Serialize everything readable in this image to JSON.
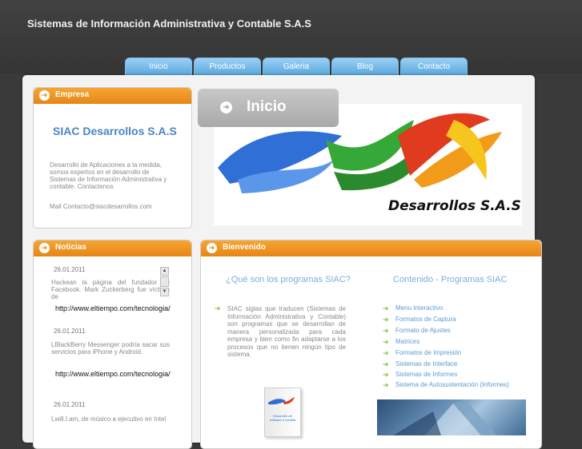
{
  "site": {
    "title": "Sistemas de Información Administrativa y Contable S.A.S"
  },
  "nav": {
    "tabs": [
      "Inicio",
      "Productos",
      "Galeria",
      "Blog",
      "Contacto"
    ]
  },
  "empresa": {
    "header": "Empresa",
    "company": "SIAC Desarrollos S.A.S",
    "description": "Desarrollo de Aplicaciones a la medida, somos expertos en el desarrollo de Sistemas de Información Administrativa y contable. Contactenos",
    "mail": "Mail Contacto@siacdesarrollos.com"
  },
  "noticias": {
    "header": "Noticias",
    "items": [
      {
        "date": "26.01.2011",
        "text": "Hackean la página del fundador de Facebook. Mark Zuckerberg fue víctima de",
        "link": "http://www.eltiempo.com/tecnologia/"
      },
      {
        "date": "26.01.2011",
        "text": "LBlackBerry Messenger podría sacar sus servicios para iPhone y Android.",
        "link": "http://www.eltiempo.com/tecnologia/"
      },
      {
        "date": "26.01.2011",
        "text": "Lwill.I.am, de músico a ejecutivo en Intel"
      }
    ]
  },
  "inicio": {
    "label": "Inicio"
  },
  "logo": {
    "text": "Desarrollos S.A.S"
  },
  "bienvenido": {
    "header": "Bienvenido",
    "left_title": "¿Qué son los programas SIAC?",
    "left_text": "SIAC siglas que traducen (Sistemas de Información Administrativa y Contable) son programas que se desarrollan de manera personalizada para cada empresa y bien como fin adaptarse a los procesos que no tienen ningún tipo de sistema.",
    "right_title": "Contenido - Programas SIAC",
    "items": [
      "Menu Interactivo",
      "Formatos de Captura",
      "Formato de Ajustes",
      "Matrices",
      "Formatos de Impresión",
      "Sistemas de Interface",
      "Sistemas de Informes",
      "Sistema de Autosustentación (Informes)"
    ],
    "product_box_text": "Desarrollo de software a medida"
  },
  "colors": {
    "accent_orange": "#e8891a",
    "nav_blue": "#6fb6e6",
    "link_blue": "#5b9bd1",
    "green": "#80c73a"
  }
}
